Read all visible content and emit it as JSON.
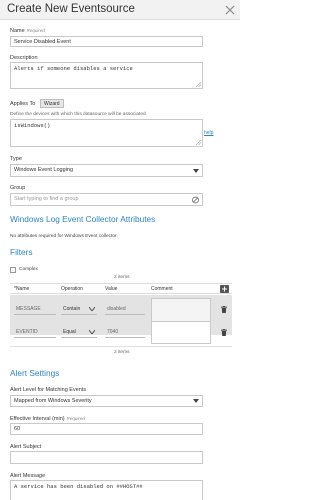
{
  "header": {
    "title": "Create New Eventsource"
  },
  "name": {
    "label": "Name",
    "required": "Required",
    "value": "Service Disabled Event"
  },
  "description": {
    "label": "Description",
    "value": "Alerts if someone disables a service"
  },
  "applies_to": {
    "label": "Applies To",
    "wizard_label": "Wizard",
    "hint": "Define the devices with which this datasource will be associated.",
    "value": "isWindows()",
    "help_label": "help"
  },
  "type": {
    "label": "Type",
    "value": "Windows Event Logging"
  },
  "group": {
    "label": "Group",
    "placeholder": "Start typing to find a group"
  },
  "collector": {
    "title": "Windows Log Event Collector Attributes",
    "note": "No attributes required for Windows Event collector."
  },
  "filters": {
    "title": "Filters",
    "complex_label": "Complex",
    "count_top": "2 items",
    "count_bottom": "2 items",
    "columns": {
      "name": "*Name",
      "operation": "Operation",
      "value": "Value",
      "comment": "Comment"
    },
    "rows": [
      {
        "name": "MESSAGE",
        "operation": "Contain",
        "value": "disabled",
        "comment": ""
      },
      {
        "name": "EVENTID",
        "operation": "Equal",
        "value": "7040",
        "comment": ""
      }
    ]
  },
  "alert": {
    "title": "Alert Settings",
    "level_label": "Alert Level for Matching Events",
    "level_value": "Mapped from Windows Severity",
    "interval_label": "Effective Interval (min)",
    "interval_required": "Required",
    "interval_value": "60",
    "subject_label": "Alert Subject",
    "subject_value": "",
    "message_label": "Alert Message",
    "message_value": "A service has been disabled on ##HOST##"
  },
  "colors": {
    "accent": "#2e86c1",
    "header_bg": "#f2f2f2",
    "row_shade": "#e3e3e3"
  }
}
